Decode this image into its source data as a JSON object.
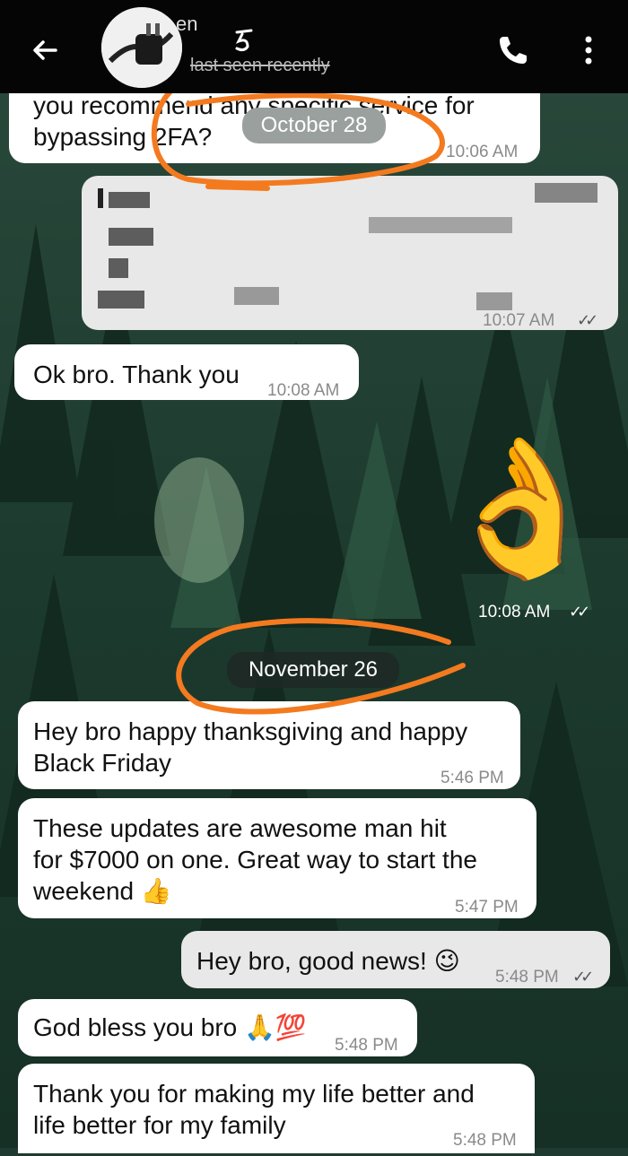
{
  "header": {
    "contact_name": "en",
    "status": "last seen recently",
    "back_icon": "arrow-left-icon",
    "call_icon": "phone-icon",
    "menu_icon": "more-vertical-icon"
  },
  "messages": [
    {
      "id": "m1",
      "text": "you recommend any specific service for bypassing 2FA?",
      "time": "10:06 AM",
      "dir": "in"
    },
    {
      "id": "m2",
      "text": "",
      "time": "10:07 AM",
      "dir": "out",
      "redacted": true
    },
    {
      "id": "m3",
      "text": "Ok bro. Thank you",
      "time": "10:08 AM",
      "dir": "in"
    },
    {
      "id": "m4",
      "emoji": "👌",
      "time": "10:08 AM",
      "dir": "out"
    },
    {
      "id": "m5",
      "text_line1": "Hey bro happy thanksgiving and happy",
      "text_line2": "Black Friday",
      "time": "5:46 PM",
      "dir": "in"
    },
    {
      "id": "m6",
      "text_line1": "These updates are awesome man hit",
      "text_line2": "for $7000 on one. Great way to start the",
      "text_line3": "weekend 👍",
      "time": "5:47 PM",
      "dir": "in"
    },
    {
      "id": "m7",
      "text": "Hey bro, good news! 😉",
      "time": "5:48 PM",
      "dir": "out"
    },
    {
      "id": "m8",
      "text": "God bless you bro 🙏💯",
      "time": "5:48 PM",
      "dir": "in"
    },
    {
      "id": "m9",
      "text_line1": "Thank you for making my life better and",
      "text_line2": "life better for my family",
      "time": "5:48 PM",
      "dir": "in"
    }
  ],
  "dates": {
    "oct": "October 28",
    "nov": "November 26"
  },
  "m1": {
    "line1": "you recommend any specific service for",
    "line2": "bypassing 2FA?"
  },
  "ticks": "✓✓",
  "colors": {
    "annotation": "#f47a1f",
    "header": "#050505",
    "bubble_in": "#ffffff",
    "bubble_out": "#e8e8e8"
  }
}
